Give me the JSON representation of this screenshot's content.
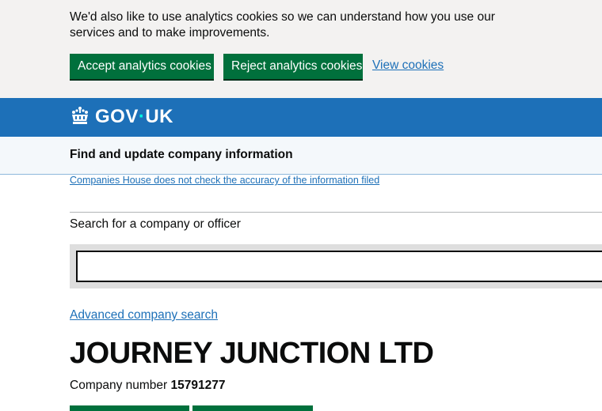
{
  "cookie_banner": {
    "message": "We'd also like to use analytics cookies so we can understand how you use our services and to make improvements.",
    "accept_label": "Accept analytics cookies",
    "reject_label": "Reject analytics cookies",
    "view_label": "View cookies"
  },
  "header": {
    "logo_left": "GOV",
    "logo_dot": "·",
    "logo_right": "UK",
    "logo_icon": "crown-icon"
  },
  "service": {
    "name": "Find and update company information"
  },
  "notice": {
    "accuracy_link": "Companies House does not check the accuracy of the information filed"
  },
  "search": {
    "label": "Search for a company or officer",
    "value": "",
    "placeholder": ""
  },
  "advanced_search_label": "Advanced company search",
  "company": {
    "name": "JOURNEY JUNCTION LTD",
    "number_label": "Company number",
    "number": "15791277"
  },
  "colors": {
    "brand_blue": "#1d70b8",
    "button_green": "#00703c",
    "banner_grey": "#f3f2f1",
    "link_blue": "#1d70b8"
  }
}
